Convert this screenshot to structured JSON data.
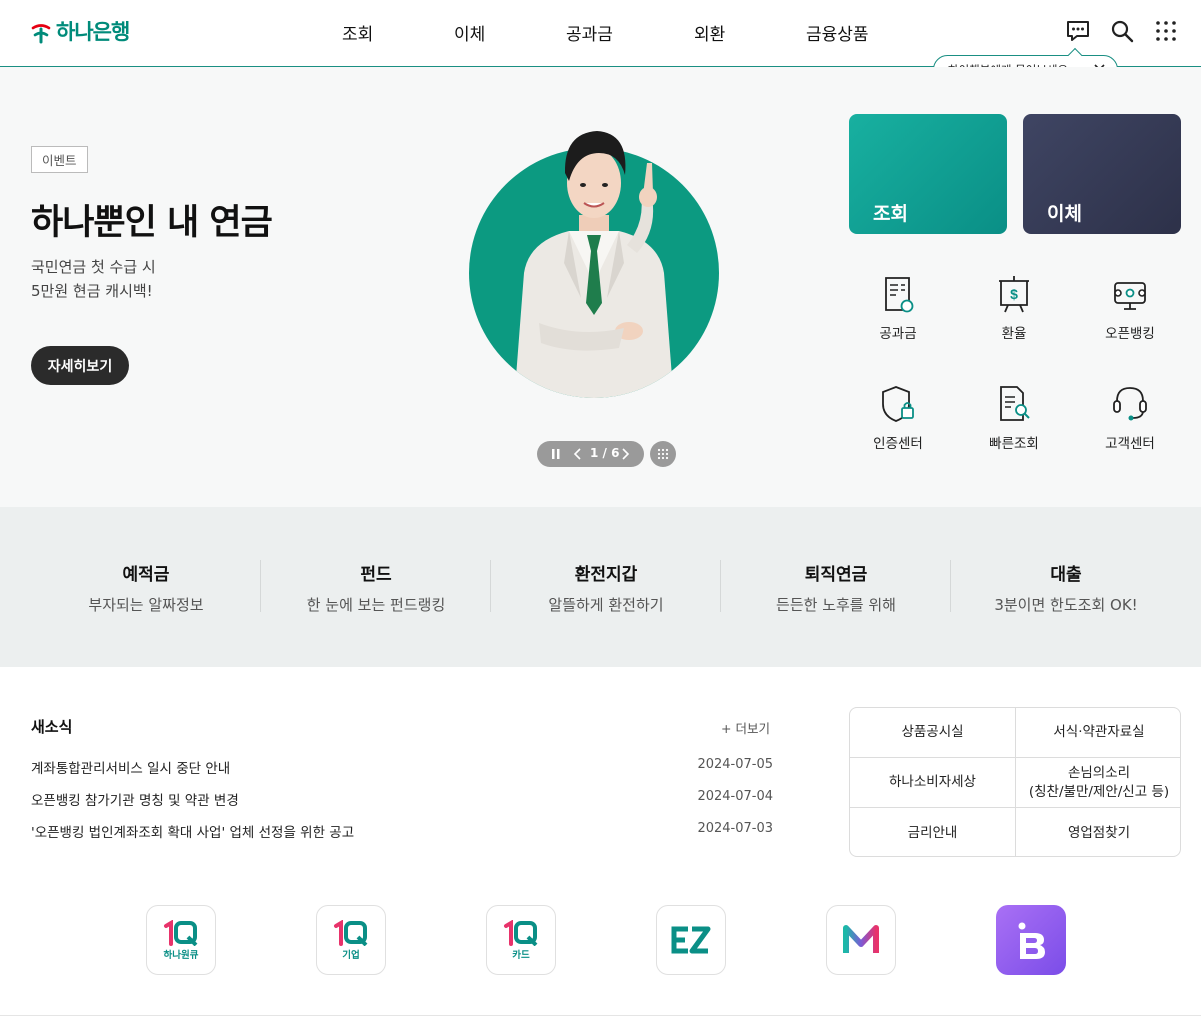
{
  "header": {
    "logo_text": "하나은행",
    "nav": [
      "조회",
      "이체",
      "공과금",
      "외환",
      "금융상품"
    ],
    "chatbot_tooltip": "하이챗봇에게 물어보세요~",
    "brand_color": "#008b7a"
  },
  "hero": {
    "tag": "이벤트",
    "title": "하나뿐인 내 연금",
    "desc_line1": "국민연금 첫 수급 시",
    "desc_line2": "5만원 현금 캐시백!",
    "cta": "자세히보기",
    "pager": "1 / 6",
    "pager_current": 1,
    "pager_total": 6
  },
  "quick": {
    "primary": [
      "조회",
      "이체"
    ],
    "items": [
      {
        "label": "공과금",
        "icon": "bill-icon"
      },
      {
        "label": "환율",
        "icon": "exchange-rate-icon"
      },
      {
        "label": "오픈뱅킹",
        "icon": "open-banking-icon"
      },
      {
        "label": "인증센터",
        "icon": "certificate-shield-icon"
      },
      {
        "label": "빠른조회",
        "icon": "document-search-icon"
      },
      {
        "label": "고객센터",
        "icon": "headset-icon"
      }
    ]
  },
  "products": [
    {
      "title": "예적금",
      "sub": "부자되는 알짜정보"
    },
    {
      "title": "펀드",
      "sub": "한 눈에 보는 펀드랭킹"
    },
    {
      "title": "환전지갑",
      "sub": "알뜰하게 환전하기"
    },
    {
      "title": "퇴직연금",
      "sub": "든든한 노후를 위해"
    },
    {
      "title": "대출",
      "sub": "3분이면 한도조회 OK!"
    }
  ],
  "news": {
    "title": "새소식",
    "more": "+ 더보기",
    "items": [
      {
        "text": "계좌통합관리서비스 일시 중단 안내",
        "date": "2024-07-05"
      },
      {
        "text": "오픈뱅킹 참가기관 명칭 및 약관 변경",
        "date": "2024-07-04"
      },
      {
        "text": "'오픈뱅킹 법인계좌조회 확대 사업' 업체 선정을 위한 공고",
        "date": "2024-07-03"
      }
    ]
  },
  "services": [
    "상품공시실",
    "서식·약관자료실",
    "하나소비자세상",
    "손님의소리\n(칭찬/불만/제안/신고 등)",
    "금리안내",
    "영업점찾기"
  ],
  "services_text": {
    "voice_line1": "손님의소리",
    "voice_line2": "(칭찬/불만/제안/신고 등)"
  },
  "apps": [
    {
      "label": "1Q",
      "sub": "하나원큐"
    },
    {
      "label": "1Q",
      "sub": "기업"
    },
    {
      "label": "1Q",
      "sub": "카드"
    },
    {
      "label": "EZ",
      "sub": ""
    },
    {
      "label": "M",
      "sub": ""
    },
    {
      "label": "B",
      "sub": ""
    }
  ]
}
